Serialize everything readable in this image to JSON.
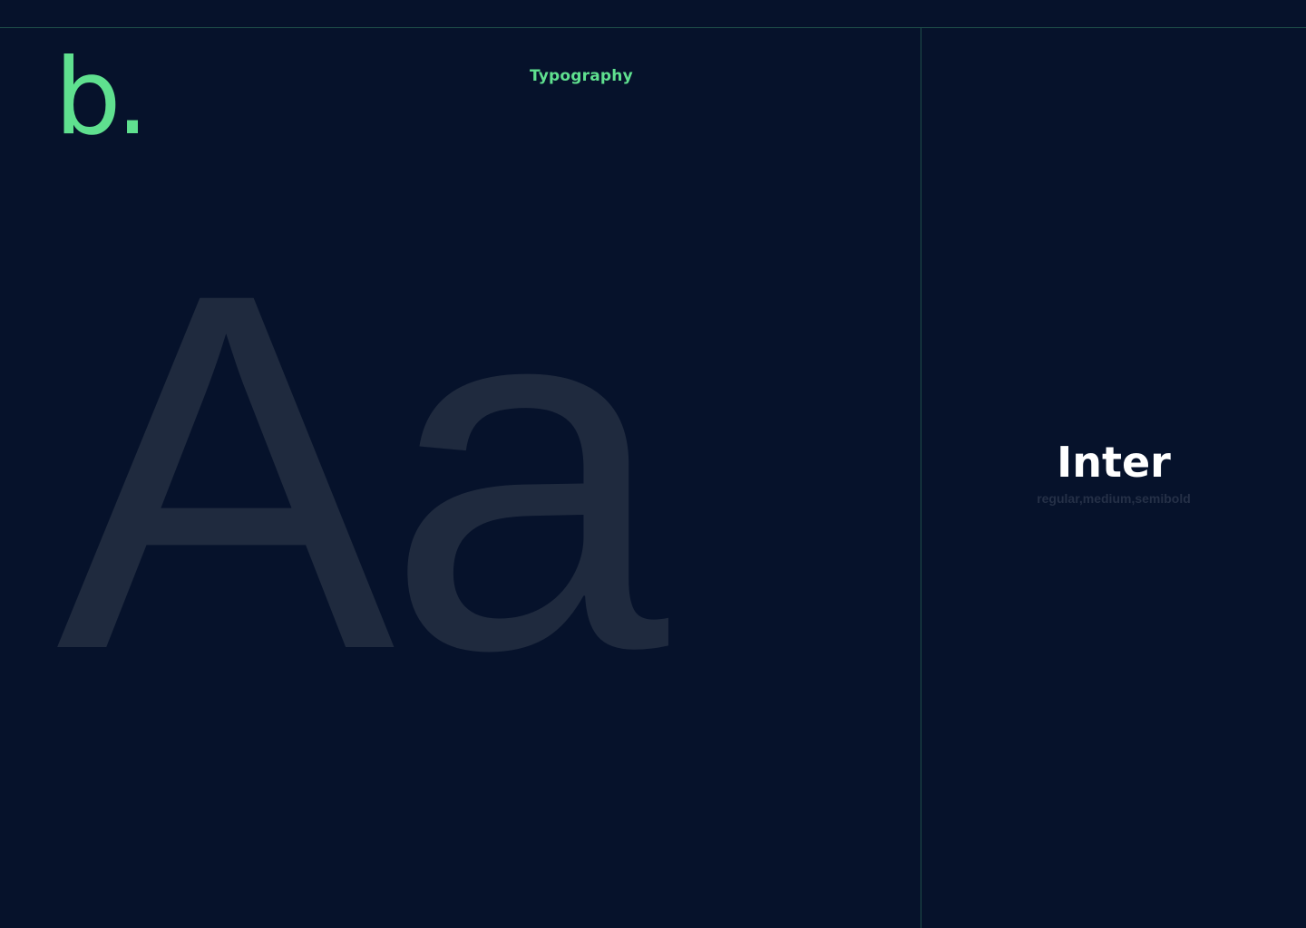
{
  "logo": {
    "text": "b."
  },
  "section": {
    "title": "Typography"
  },
  "specimen": {
    "sample": "Aa"
  },
  "font": {
    "name": "Inter",
    "weights": "regular,medium,semibold"
  },
  "colors": {
    "background": "#06122b",
    "accent": "#5fe08f",
    "divider": "#1f4f4a",
    "specimen": "#1f2a3e",
    "muted": "#253047",
    "heading": "#ffffff"
  }
}
